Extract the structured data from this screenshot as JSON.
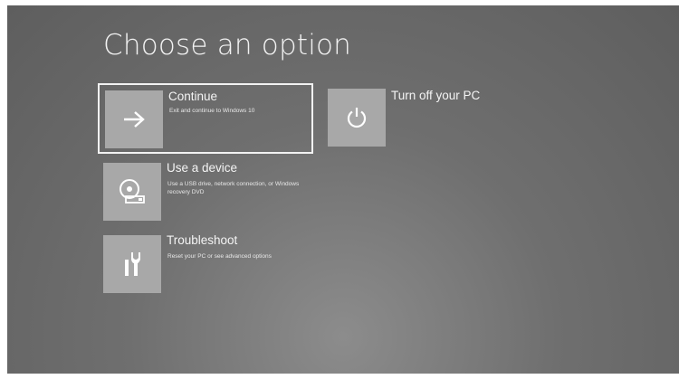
{
  "page": {
    "title": "Choose an option"
  },
  "options": {
    "continue": {
      "label": "Continue",
      "description": "Exit and continue to Windows 10",
      "icon": "arrow-right-icon"
    },
    "turn_off": {
      "label": "Turn off your PC",
      "icon": "power-icon"
    },
    "use_device": {
      "label": "Use a device",
      "description": "Use a USB drive, network connection, or Windows recovery DVD",
      "icon": "disc-drive-icon"
    },
    "troubleshoot": {
      "label": "Troubleshoot",
      "description": "Reset your PC or see advanced options",
      "icon": "tools-icon"
    }
  },
  "colors": {
    "background": "#6f6f6f",
    "tile": "#a8a8a8",
    "text": "#f2f2f2",
    "selection_border": "#f2f2f2"
  }
}
